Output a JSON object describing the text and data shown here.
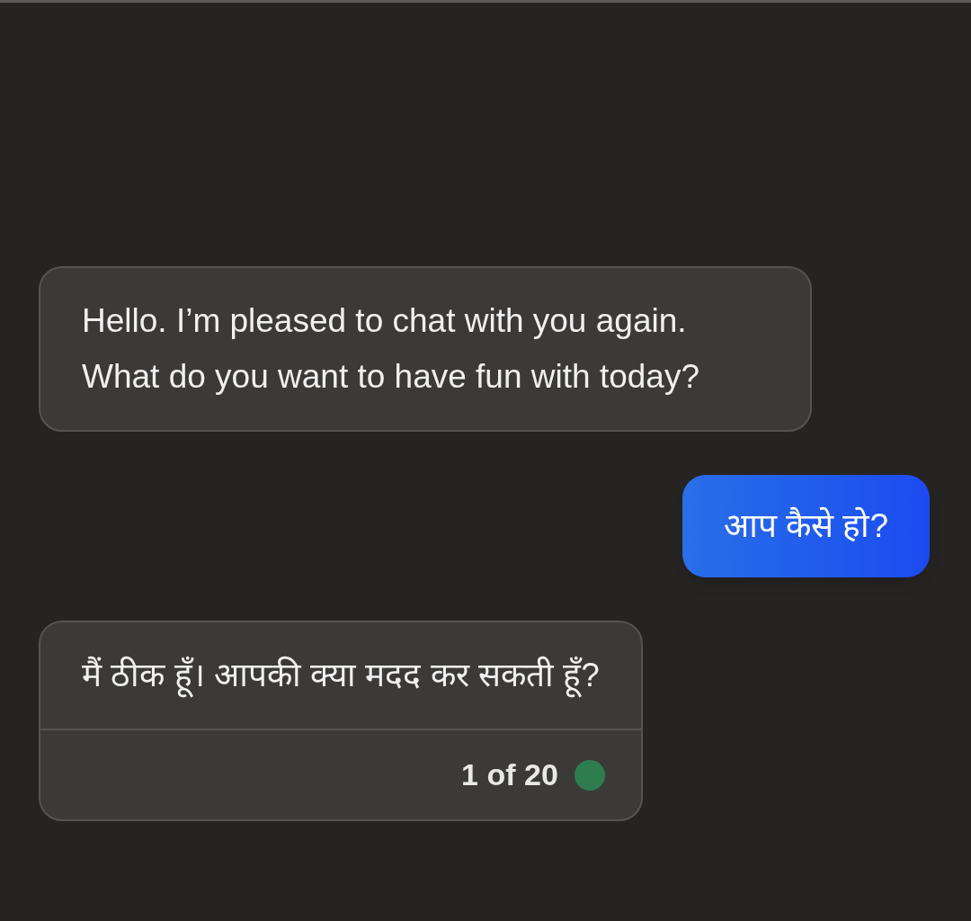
{
  "messages": [
    {
      "kind": "bot",
      "text": "Hello. I’m pleased to chat with you again. What do you want to have fun with today?"
    },
    {
      "kind": "user",
      "text": "आप कैसे हो?"
    },
    {
      "kind": "bot",
      "text": "मैं ठीक हूँ। आपकी क्या मदद कर सकती हूँ?",
      "footer": {
        "counter": "1 of 20",
        "color": "#2e7d4f"
      }
    }
  ]
}
